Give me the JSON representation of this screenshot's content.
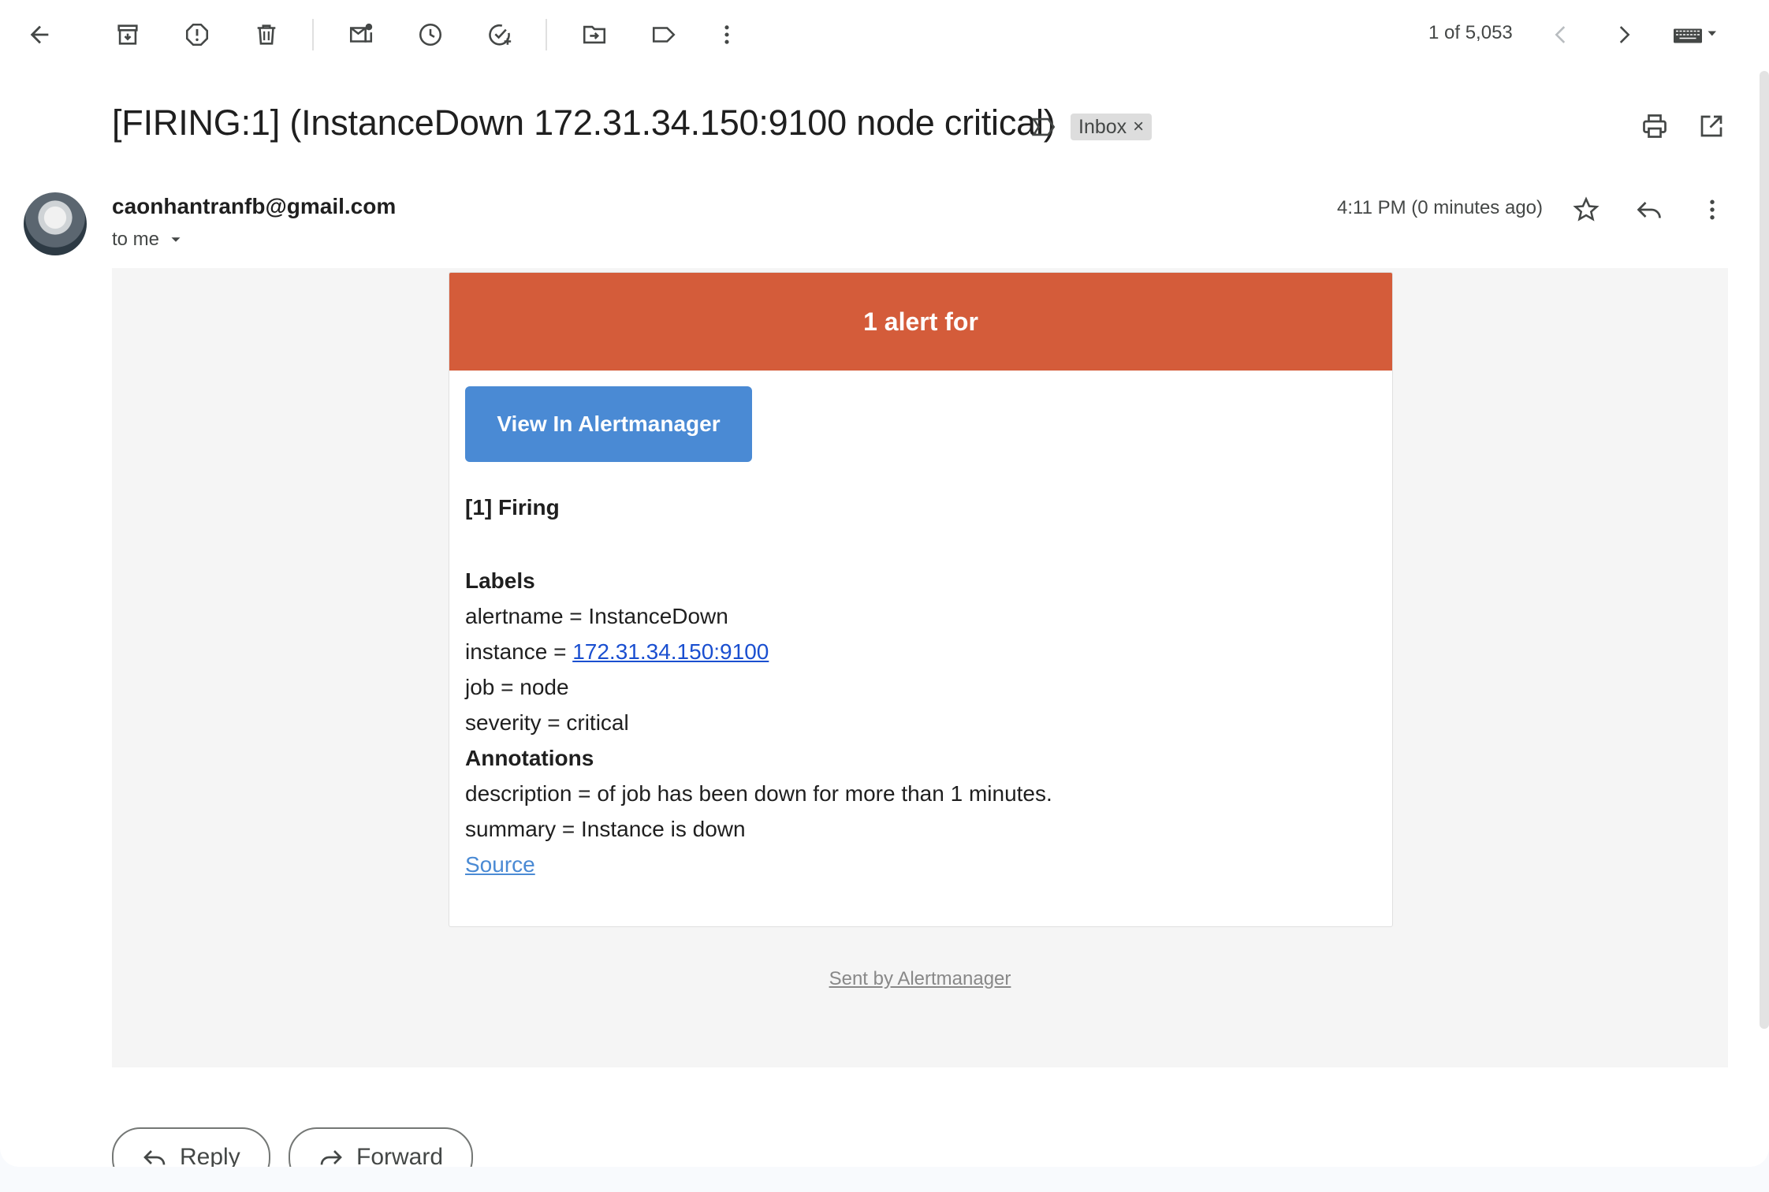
{
  "toolbar": {
    "back": "back-arrow-icon",
    "archive": "archive-icon",
    "report_spam": "report-spam-icon",
    "delete": "trash-icon",
    "mark_unread": "mark-unread-icon",
    "snooze": "clock-icon",
    "add_task": "add-task-icon",
    "move_to": "move-to-icon",
    "labels": "label-icon",
    "more": "more-vert-icon",
    "pager_text": "1 of 5,053"
  },
  "email": {
    "subject": "[FIRING:1] (InstanceDown 172.31.34.150:9100 node critical)",
    "label_chip": "Inbox",
    "label_chip_remove": "×",
    "sender": "caonhantranfb@gmail.com",
    "recipient_text": "to me",
    "time_text": "4:11 PM (0 minutes ago)"
  },
  "alert": {
    "banner_text": "1 alert for",
    "banner_color": "#d45c3a",
    "button_label": "View In Alertmanager",
    "button_color": "#4a8ad4",
    "firing_heading": "[1] Firing",
    "labels_heading": "Labels",
    "alertname_line": "alertname = InstanceDown",
    "instance_prefix": "instance = ",
    "instance_link": "172.31.34.150:9100",
    "job_line": "job = node",
    "severity_line": "severity = critical",
    "annotations_heading": "Annotations",
    "description_line": "description = of job has been down for more than 1 minutes.",
    "summary_line": "summary = Instance is down",
    "source_link": "Source",
    "footer_link": "Sent by Alertmanager"
  },
  "actions": {
    "reply_label": "Reply",
    "forward_label": "Forward"
  }
}
